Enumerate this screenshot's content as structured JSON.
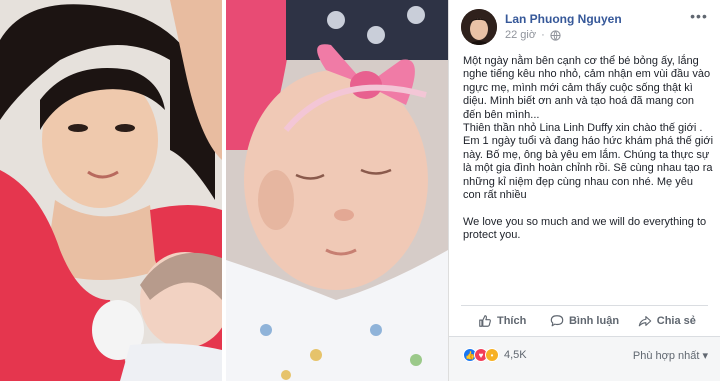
{
  "post": {
    "author": "Lan Phuong Nguyen",
    "time": "22 giờ",
    "more_icon": "ellipsis-icon",
    "privacy_icon": "globe-icon",
    "paragraphs": [
      "Một ngày nằm bên cạnh cơ thể bé bỏng ấy, lắng nghe tiếng kêu nho nhỏ, cảm nhận em vùi đầu vào ngực mẹ, mình mới cảm thấy cuộc sống thật kì diệu. Mình biết ơn anh và tạo hoá đã mang con đến bên mình...",
      "Thiên thần nhỏ Lina Linh Duffy xin chào thế giới .",
      "Em 1 ngày tuổi và đang háo hức khám phá thế giới này. Bố mẹ, ông bà yêu em lắm. Chúng ta thực sự là một gia đình hoàn chỉnh rồi. Sẽ cùng nhau tạo ra những kỉ niệm đẹp cùng nhau con nhé. Mẹ yêu con rất nhiều",
      "",
      "We love you so much and we will do everything to protect you."
    ]
  },
  "actions": {
    "like": "Thích",
    "comment": "Bình luận",
    "share": "Chia sẻ"
  },
  "footer": {
    "reaction_count": "4,5K",
    "sort": "Phù hợp nhất ▾"
  },
  "colors": {
    "link": "#365899",
    "like_blue": "#1877f2",
    "love_red": "#f33e58",
    "wow_yellow": "#f7b125"
  }
}
